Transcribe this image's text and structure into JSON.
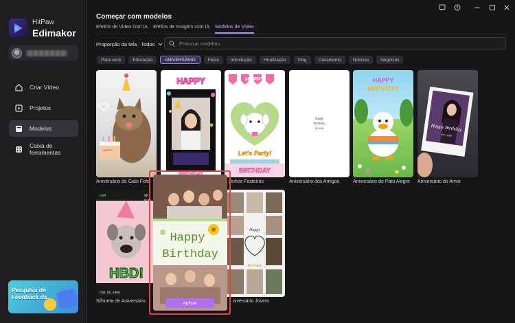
{
  "app": {
    "brand_small": "HitPaw",
    "brand_large": "Edimakor"
  },
  "nav": [
    {
      "label": "Criar Vídeo",
      "icon": "create-video-icon"
    },
    {
      "label": "Projetos",
      "icon": "projects-icon"
    },
    {
      "label": "Modelos",
      "icon": "templates-icon"
    },
    {
      "label": "Caixa de ferramentas",
      "icon": "toolbox-icon"
    }
  ],
  "feedback": {
    "text": "Pesquisa de Feedback da"
  },
  "header": {
    "title": "Começar com modelos",
    "tabs": [
      "Efeitos de Vídeo com IA",
      "Efeitos de Imagem com IA",
      "Modelos de Vídeo"
    ],
    "ratio_label": "Proporção da tela : Todos",
    "search_placeholder": "Procurar modelos"
  },
  "categories": [
    "Para você",
    "Educação",
    "ANIVERSÁRIO",
    "Festa",
    "Introdução",
    "Finalização",
    "Vlog",
    "Casamento",
    "Notícias",
    "Negócios"
  ],
  "templates": [
    {
      "caption": "Aniversário de Gato Fofo"
    },
    {
      "caption": "",
      "top_text": "HAPPY",
      "bottom_text": "BIRTHDAY"
    },
    {
      "caption": "zinhos Festeiros",
      "top_text": "HAPPY",
      "party": "Let's Party!",
      "bottom_text": "BIRTHDAY"
    },
    {
      "caption": "Aniversário dos Amigos",
      "script1": "happy",
      "script2": "birthday",
      "script3": "to you"
    },
    {
      "caption": "Aniversário do Pato Alegre",
      "top_text": "HAPPY",
      "bottom_text": "BIRTHDAY"
    },
    {
      "caption": "Aniversário do Amor",
      "script": "Happy Birthday",
      "sub": "MY LOVE"
    },
    {
      "caption": "Silhueta de Aniversário",
      "hud_left": "CAM",
      "hud_right": "SP",
      "hud_time": "0:00",
      "hbd": "HBD!",
      "date": "FEB.02.2008"
    },
    {
      "caption": "",
      "line1": "Happy",
      "line2": "Birthday",
      "apply": "Aplicar"
    },
    {
      "caption": "niversário Jovem",
      "script1": "Happy",
      "script2": "Birthday"
    }
  ]
}
